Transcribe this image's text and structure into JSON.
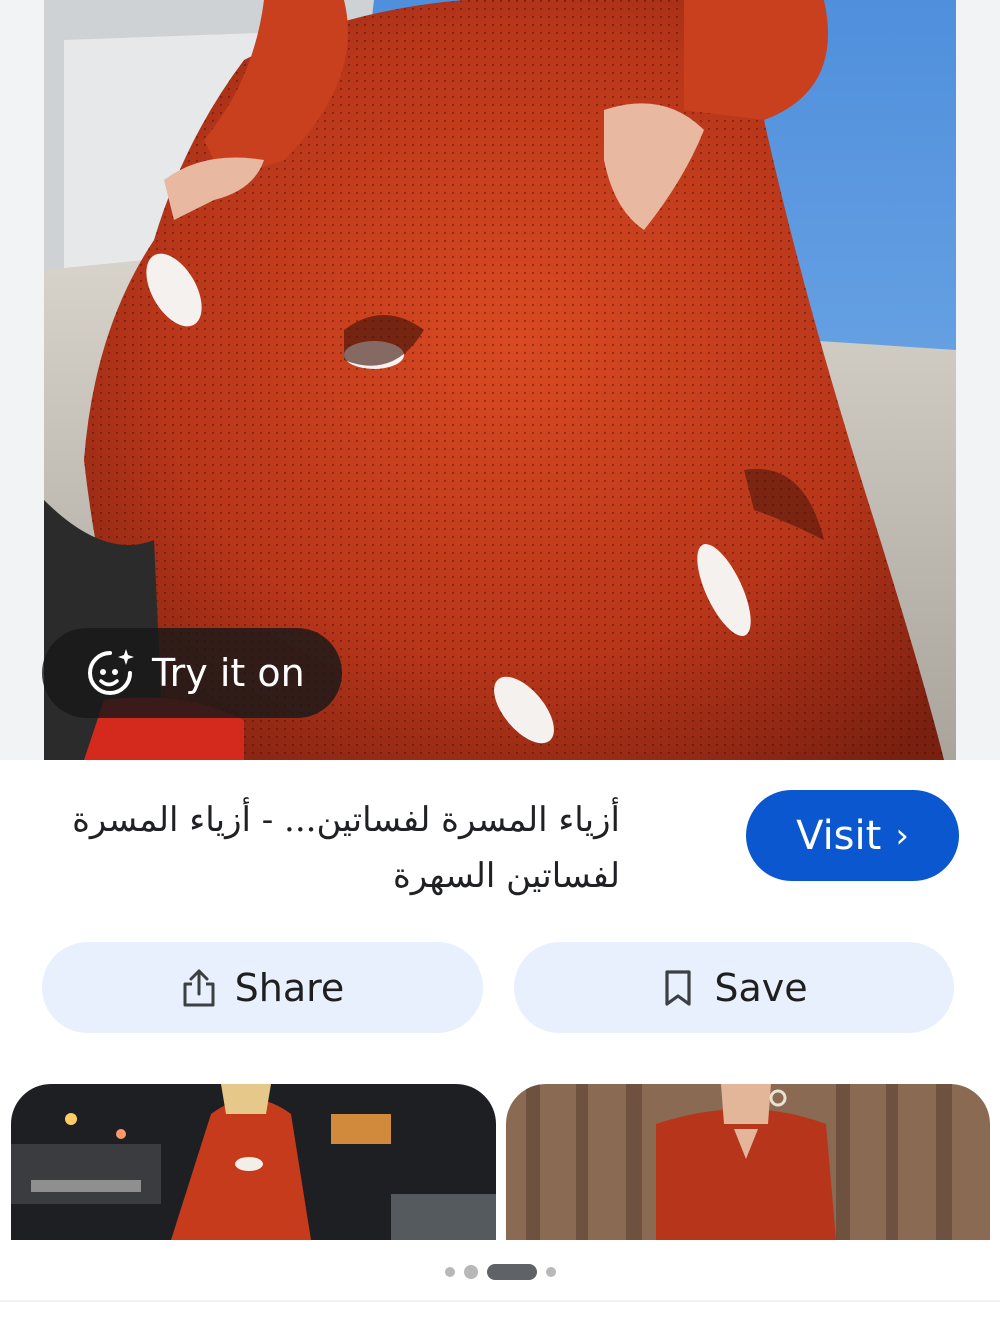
{
  "hero": {
    "image_alt": "red printed maxi dress",
    "try_on_label": "Try it on",
    "try_on_icon": "face-sparkle-icon"
  },
  "result": {
    "title": "أزياء المسرة لفساتين... - أزياء المسرة لفساتين السهرة",
    "visit_label": "Visit",
    "visit_icon": "chevron-right-icon"
  },
  "actions": {
    "share_label": "Share",
    "share_icon": "share-icon",
    "save_label": "Save",
    "save_icon": "bookmark-icon"
  },
  "related": {
    "thumbs": [
      "street style red dress",
      "red dress with choker neckline"
    ]
  },
  "pager": {
    "count": 4,
    "active_index": 2
  },
  "colors": {
    "accent": "#0b57d0",
    "button_tonal": "#e8f0fe",
    "dress_red": "#c23a1e",
    "sky": "#5b9be0"
  }
}
